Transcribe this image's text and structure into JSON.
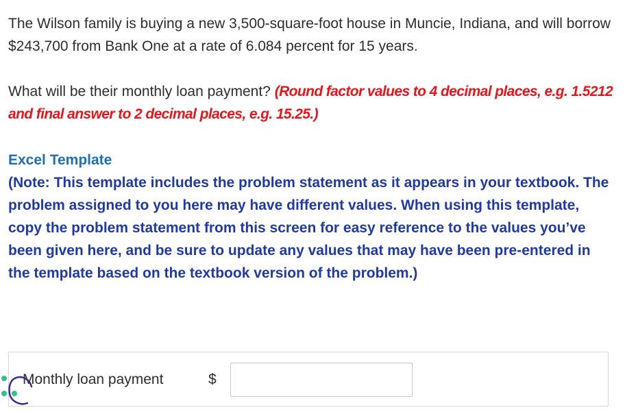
{
  "problem": {
    "statement": "The Wilson family is buying a new 3,500-square-foot house in Muncie, Indiana, and will borrow $243,700 from Bank One at a rate of 6.084 percent for 15 years."
  },
  "question": {
    "text": "What will be their monthly loan payment? ",
    "hint": "(Round factor values to 4 decimal places, e.g. 1.5212 and final answer to 2 decimal places, e.g. 15.25.)"
  },
  "excel": {
    "link_label": "Excel Template",
    "note": "(Note: This template includes the problem statement as it appears in your textbook. The problem assigned to you here may have different values. When using this template, copy the problem statement from this screen for easy reference to the values you’ve been given here, and be sure to update any values that may have been pre-entered in the template based on the textbook version of the problem.)"
  },
  "answer": {
    "label": "Monthly loan payment",
    "currency_symbol": "$",
    "value": ""
  },
  "colors": {
    "hint_red": "#e8151b",
    "link_blue": "#1d6fb8",
    "note_blue": "#1f3aa8",
    "cursor_teal": "#2fc28a"
  },
  "icons": {
    "cursor": "hand-cursor-icon"
  }
}
